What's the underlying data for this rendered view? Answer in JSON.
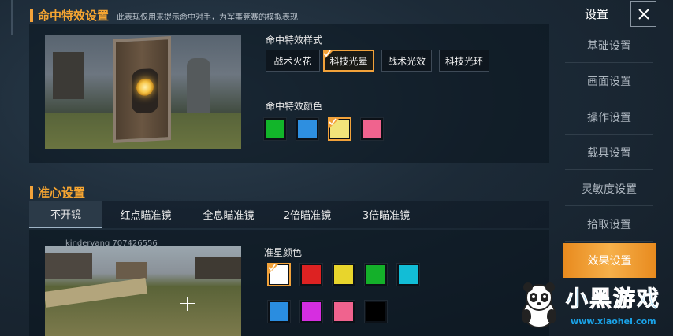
{
  "hit_effect": {
    "title": "命中特效设置",
    "description": "此表现仅用来提示命中对手，为军事竞赛的模拟表现",
    "style_label": "命中特效样式",
    "styles": [
      {
        "label": "战术火花",
        "selected": false
      },
      {
        "label": "科技光晕",
        "selected": true
      },
      {
        "label": "战术光效",
        "selected": false
      },
      {
        "label": "科技光环",
        "selected": false
      }
    ],
    "color_label": "命中特效颜色",
    "colors": [
      {
        "hex": "#12b52a",
        "selected": false
      },
      {
        "hex": "#2e8fe0",
        "selected": false
      },
      {
        "hex": "#f2e47a",
        "selected": true
      },
      {
        "hex": "#f0638e",
        "selected": false
      }
    ]
  },
  "crosshair": {
    "title": "准心设置",
    "tabs": [
      {
        "label": "不开镜",
        "active": true
      },
      {
        "label": "红点瞄准镜",
        "active": false
      },
      {
        "label": "全息瞄准镜",
        "active": false
      },
      {
        "label": "2倍瞄准镜",
        "active": false
      },
      {
        "label": "3倍瞄准镜",
        "active": false
      }
    ],
    "player_tag": "kinderyang 707426556",
    "color_label": "准星颜色",
    "colors_row1": [
      {
        "hex": "#ffffff",
        "selected": true
      },
      {
        "hex": "#dd2222",
        "selected": false
      },
      {
        "hex": "#e8d52c",
        "selected": false
      },
      {
        "hex": "#14b02a",
        "selected": false
      },
      {
        "hex": "#12bdd6",
        "selected": false
      }
    ],
    "colors_row2": [
      {
        "hex": "#2a8de0",
        "selected": false
      },
      {
        "hex": "#d62ee0",
        "selected": false
      },
      {
        "hex": "#f0638e",
        "selected": false
      },
      {
        "hex": "#000000",
        "selected": false
      }
    ]
  },
  "sidebar": {
    "title": "设置",
    "items": [
      {
        "label": "基础设置",
        "active": false
      },
      {
        "label": "画面设置",
        "active": false
      },
      {
        "label": "操作设置",
        "active": false
      },
      {
        "label": "载具设置",
        "active": false
      },
      {
        "label": "灵敏度设置",
        "active": false
      },
      {
        "label": "拾取设置",
        "active": false
      },
      {
        "label": "效果设置",
        "active": true
      }
    ]
  },
  "watermark": {
    "name_part1": "小",
    "name_part2": "黑",
    "name_part3": "游戏",
    "url": "www.xiaohei.com"
  },
  "colors": {
    "accent": "#f2a23a",
    "title_orange": "#f6a531"
  }
}
